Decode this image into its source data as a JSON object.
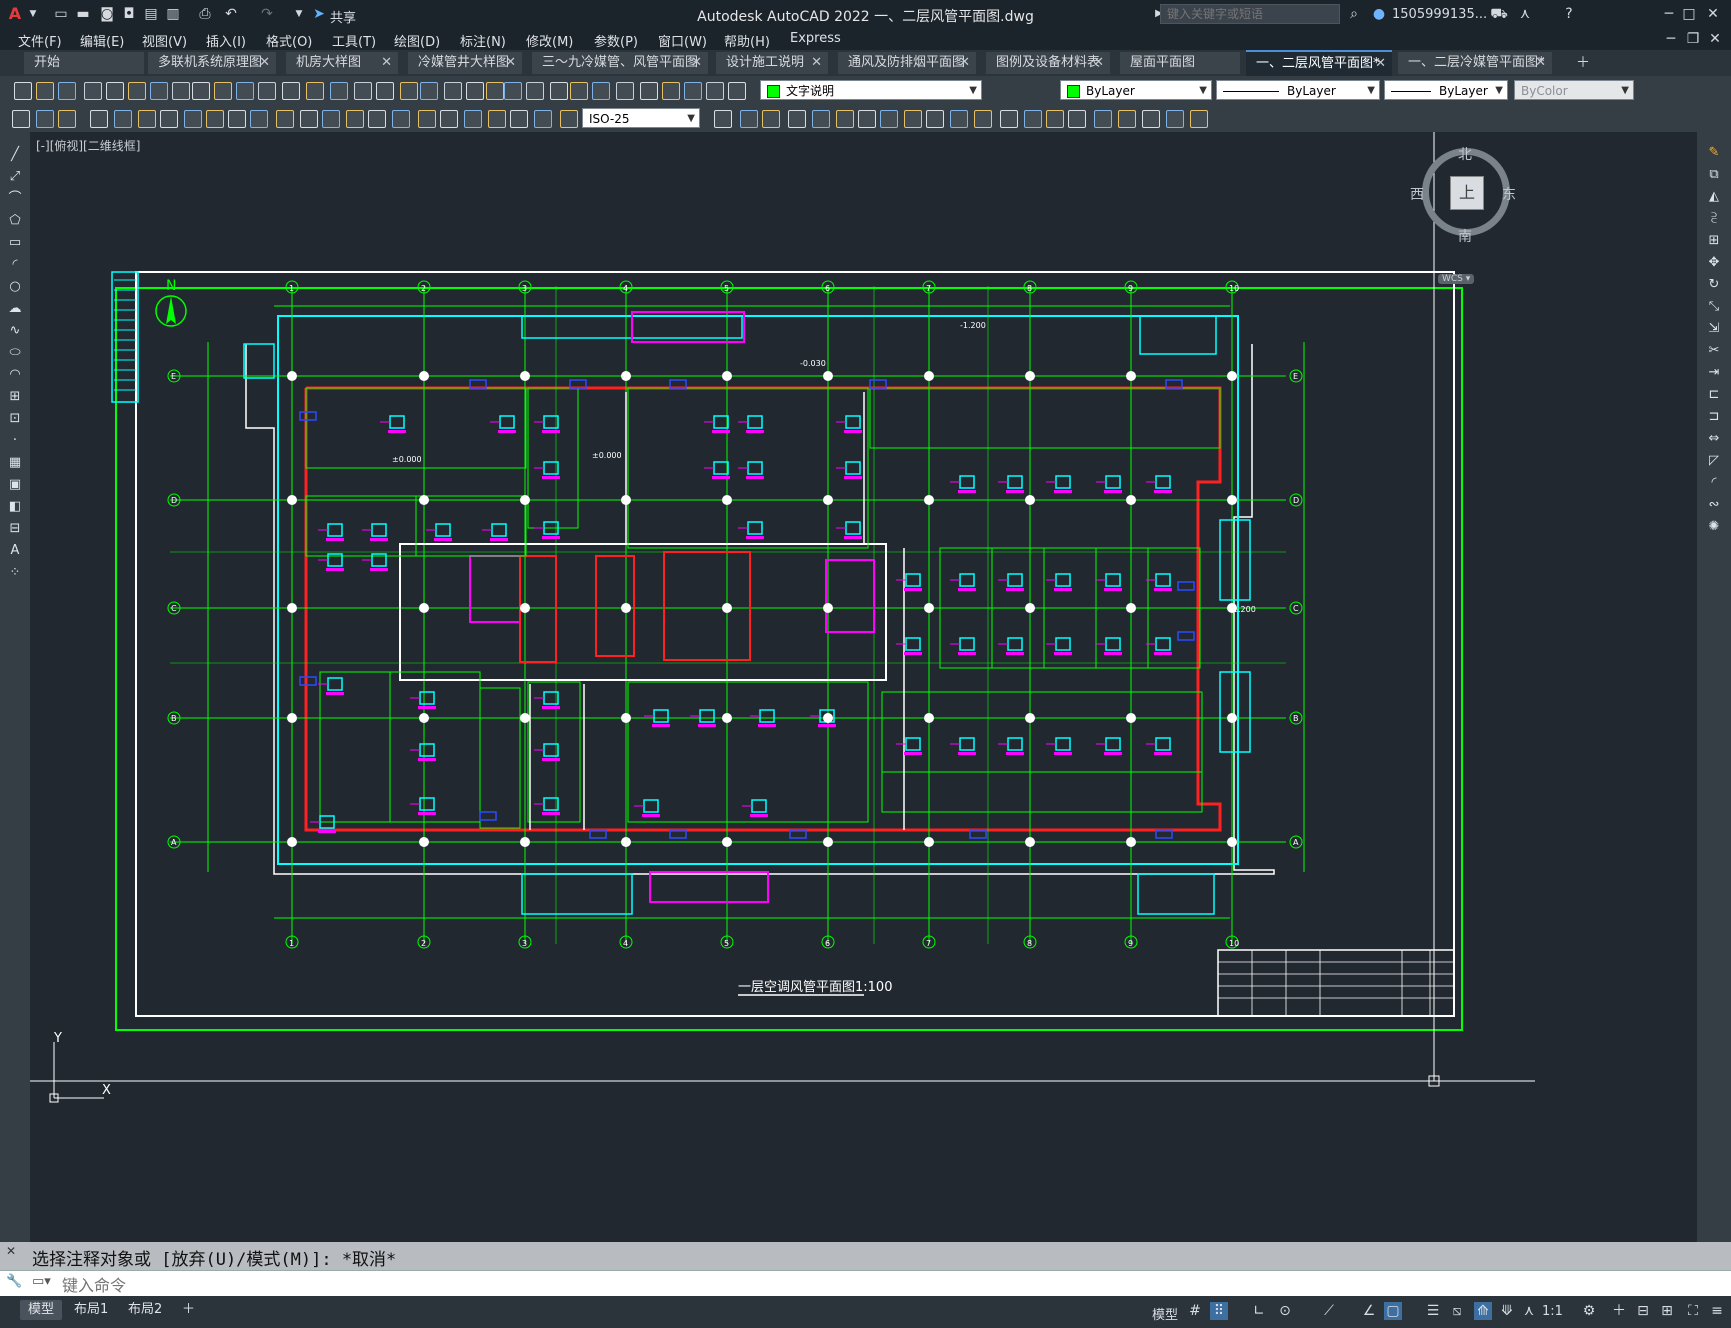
{
  "app": {
    "title": "Autodesk AutoCAD 2022    一、二层风管平面图.dwg",
    "search_placeholder": "键入关键字或短语",
    "user": "1505999135...",
    "share_label": "共享"
  },
  "menu": [
    "文件(F)",
    "编辑(E)",
    "视图(V)",
    "插入(I)",
    "格式(O)",
    "工具(T)",
    "绘图(D)",
    "标注(N)",
    "修改(M)",
    "参数(P)",
    "窗口(W)",
    "帮助(H)",
    "Express"
  ],
  "tabs": [
    {
      "label": "开始"
    },
    {
      "label": "多联机系统原理图"
    },
    {
      "label": "机房大样图"
    },
    {
      "label": "冷媒管井大样图"
    },
    {
      "label": "三～九冷媒管、风管平面图"
    },
    {
      "label": "设计施工说明"
    },
    {
      "label": "通风及防排烟平面图"
    },
    {
      "label": "图例及设备材料表"
    },
    {
      "label": "屋面平面图"
    },
    {
      "label": "一、二层风管平面图*"
    },
    {
      "label": "一、二层冷媒管平面图*"
    }
  ],
  "props": {
    "layer": "文字说明",
    "color": "ByLayer",
    "linetype": "ByLayer",
    "lineweight": "ByLayer",
    "plotstyle": "ByColor",
    "dimstyle": "ISO-25"
  },
  "viewport": {
    "label": "[-][俯视][二维线框]"
  },
  "viewcube": {
    "north": "北",
    "south": "南",
    "east": "东",
    "west": "西",
    "top": "上",
    "wcs": "WCS"
  },
  "drawing": {
    "north_label": "N",
    "plan_title": "一层空调风管平面图1:100",
    "grid_top": [
      "1",
      "2",
      "3",
      "4",
      "5",
      "6",
      "7",
      "8",
      "9",
      "10"
    ],
    "grid_side": [
      "E",
      "D",
      "C",
      "B",
      "A"
    ],
    "elev_labels": [
      "±0.000",
      "±0.000",
      "-0.030",
      "-1.200",
      "-1.200"
    ]
  },
  "command": {
    "history": "选择注释对象或 [放弃(U)/模式(M)]: *取消*",
    "placeholder": "键入命令"
  },
  "layouts": [
    "模型",
    "布局1",
    "布局2"
  ],
  "status": {
    "model": "模型",
    "scale": "1:1"
  },
  "colors": {
    "bg": "#212830",
    "grid": "#00ff00",
    "wall": "#ffffff",
    "red": "#ff0000",
    "cyan": "#00ffff",
    "magenta": "#ff00ff",
    "blue": "#0000ff"
  }
}
